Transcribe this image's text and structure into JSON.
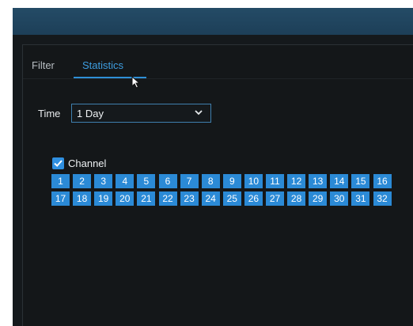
{
  "tabs": [
    {
      "label": "Filter",
      "active": false
    },
    {
      "label": "Statistics",
      "active": true
    }
  ],
  "time": {
    "label": "Time",
    "selected": "1 Day"
  },
  "channel": {
    "label": "Channel",
    "checked": true,
    "numbers": [
      "1",
      "2",
      "3",
      "4",
      "5",
      "6",
      "7",
      "8",
      "9",
      "10",
      "11",
      "12",
      "13",
      "14",
      "15",
      "16",
      "17",
      "18",
      "19",
      "20",
      "21",
      "22",
      "23",
      "24",
      "25",
      "26",
      "27",
      "28",
      "29",
      "30",
      "31",
      "32"
    ]
  },
  "colors": {
    "titlebar": "#1d3f58",
    "background": "#15191c",
    "accent": "#2e8fd6",
    "channel_chip": "#2b8ad6"
  },
  "icons": {
    "dropdown": "chevron-down-icon",
    "checkbox": "checkmark-icon",
    "pointer": "mouse-cursor-icon"
  }
}
